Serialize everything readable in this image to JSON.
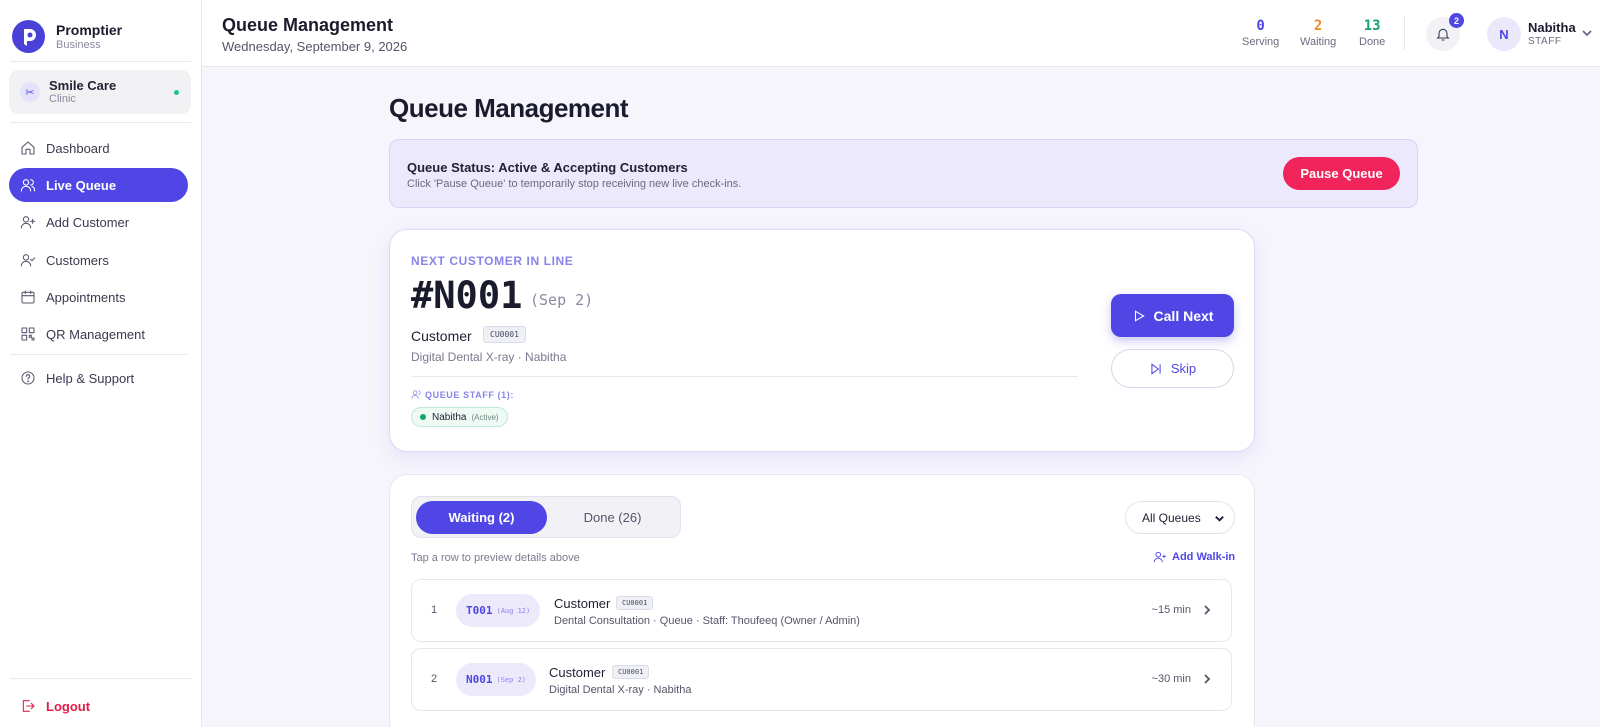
{
  "brand": {
    "name": "Promptier",
    "sub": "Business"
  },
  "clinic": {
    "name": "Smile Care",
    "sub": "Clinic"
  },
  "nav": {
    "dashboard": "Dashboard",
    "live_queue": "Live Queue",
    "add_customer": "Add Customer",
    "customers": "Customers",
    "appointments": "Appointments",
    "qr_management": "QR Management",
    "help": "Help & Support",
    "logout": "Logout"
  },
  "header": {
    "title": "Queue Management",
    "date": "Wednesday, September 9, 2026",
    "stats": {
      "serving": {
        "num": "0",
        "label": "Serving",
        "color": "#4f46e5"
      },
      "waiting": {
        "num": "2",
        "label": "Waiting",
        "color": "#f08a24"
      },
      "done": {
        "num": "13",
        "label": "Done",
        "color": "#16a36e"
      }
    },
    "notifications": "2",
    "user": {
      "initial": "N",
      "name": "Nabitha",
      "role": "STAFF"
    }
  },
  "page": {
    "title": "Queue Management"
  },
  "status": {
    "title": "Queue Status: Active & Accepting Customers",
    "desc": "Click 'Pause Queue' to temporarily stop receiving new live check-ins.",
    "pause_label": "Pause Queue"
  },
  "next": {
    "label": "NEXT CUSTOMER IN LINE",
    "ticket": "#N001",
    "date": "(Sep 2)",
    "customer": "Customer",
    "code": "CU0001",
    "meta": "Digital Dental X-ray · Nabitha",
    "staff_label": "QUEUE STAFF (1):",
    "staff_name": "Nabitha",
    "staff_status": "(Active)",
    "call_label": "Call Next",
    "skip_label": "Skip"
  },
  "list": {
    "tab_waiting": "Waiting (2)",
    "tab_done": "Done (26)",
    "queue_filter": "All Queues",
    "hint": "Tap a row to preview details above",
    "walkin_label": "Add Walk-in",
    "rows": [
      {
        "num": "1",
        "ticket": "T001",
        "date": "(Aug 12)",
        "name": "Customer",
        "code": "CU0001",
        "meta": "Dental Consultation · Queue · Staff: Thoufeeq (Owner / Admin)",
        "eta": "~15 min"
      },
      {
        "num": "2",
        "ticket": "N001",
        "date": "(Sep 2)",
        "name": "Customer",
        "code": "CU0001",
        "meta": "Digital Dental X-ray · Nabitha",
        "eta": "~30 min"
      }
    ]
  }
}
